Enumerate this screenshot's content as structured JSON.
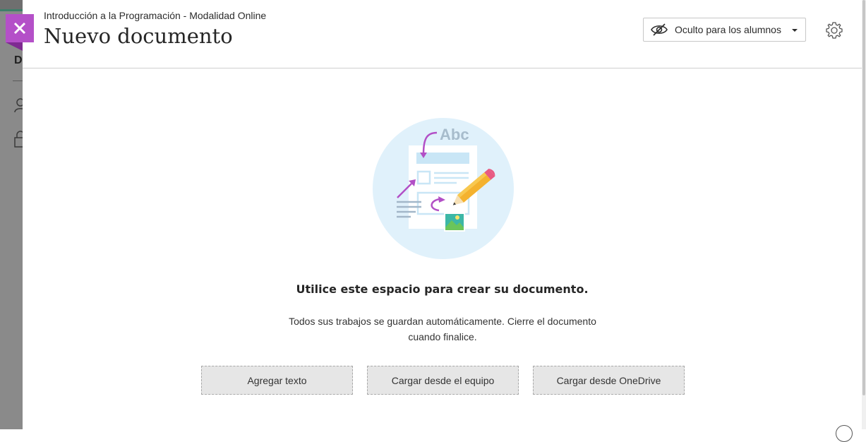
{
  "header": {
    "breadcrumb": "Introducción a la Programación - Modalidad Online",
    "title": "Nuevo documento",
    "visibility": {
      "selected": "Oculto para los alumnos",
      "icon": "eye-hidden-icon"
    },
    "settings_icon": "gear-icon"
  },
  "close": {
    "icon": "close-icon",
    "color": "#b450c8"
  },
  "illustration": {
    "text": "Abc"
  },
  "empty_state": {
    "heading": "Utilice este espacio para crear su documento.",
    "description": "Todos sus trabajos se guardan automáticamente. Cierre el documento cuando finalice."
  },
  "actions": {
    "add_text": "Agregar texto",
    "upload_computer": "Cargar desde el equipo",
    "upload_onedrive": "Cargar desde OneDrive"
  },
  "background": {
    "letter": "D"
  }
}
